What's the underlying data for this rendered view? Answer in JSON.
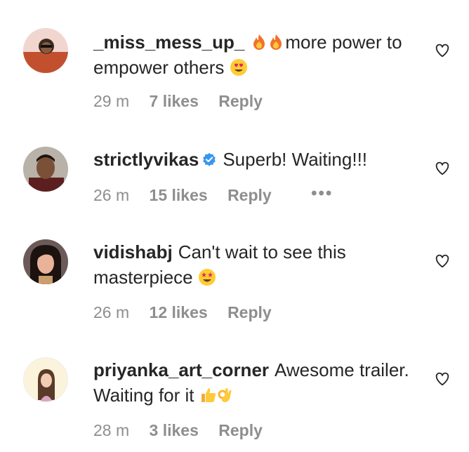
{
  "comments": [
    {
      "username": "_miss_mess_up_",
      "verified": false,
      "text_before": "",
      "text_after": "more power to empower others",
      "time": "29 m",
      "likes": "7 likes",
      "reply": "Reply",
      "avatar_icon": "avatar-photo"
    },
    {
      "username": "strictlyvikas",
      "verified": true,
      "text_after": "Superb! Waiting!!!",
      "time": "26 m",
      "likes": "15 likes",
      "reply": "Reply",
      "more": "•••",
      "avatar_icon": "avatar-photo"
    },
    {
      "username": "vidishabj",
      "verified": false,
      "text_after": "Can't wait to see this masterpiece",
      "time": "26 m",
      "likes": "12 likes",
      "reply": "Reply",
      "avatar_icon": "avatar-photo"
    },
    {
      "username": "priyanka_art_corner",
      "verified": false,
      "text_after": "Awesome trailer. Waiting for it",
      "time": "28 m",
      "likes": "3 likes",
      "reply": "Reply",
      "avatar_icon": "avatar-illustration"
    }
  ],
  "icons": {
    "like": "heart-outline-icon",
    "verified": "verified-badge-icon"
  },
  "colors": {
    "text": "#262626",
    "meta": "#8e8e8e",
    "verified": "#3897f0"
  }
}
